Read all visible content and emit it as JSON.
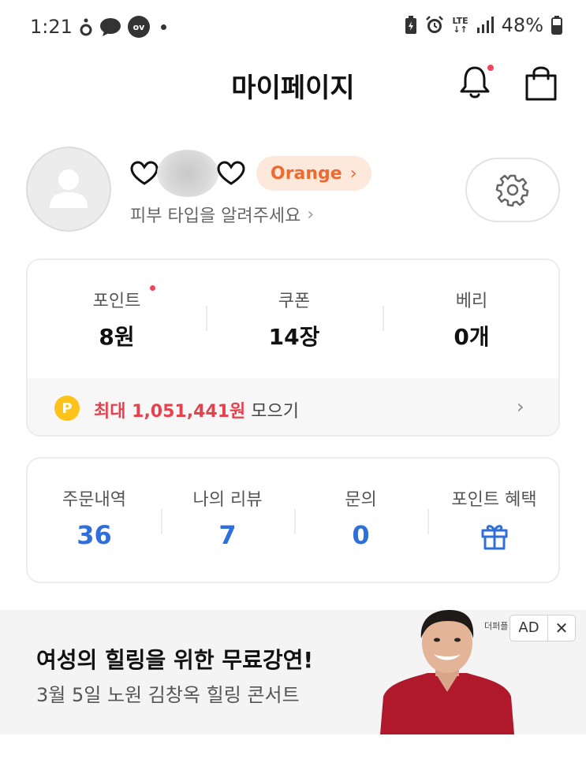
{
  "status_bar": {
    "time": "1:21",
    "ov_label": "ov",
    "battery": "48%",
    "network": "LTE"
  },
  "header": {
    "title": "마이페이지"
  },
  "profile": {
    "grade": "Orange",
    "skin_type_prompt": "피부 타입을 알려주세요"
  },
  "stats": [
    {
      "label": "포인트",
      "value": "8원"
    },
    {
      "label": "쿠폰",
      "value": "14장"
    },
    {
      "label": "베리",
      "value": "0개"
    }
  ],
  "collect": {
    "coin": "P",
    "highlight": "최대 1,051,441원",
    "suffix": " 모으기"
  },
  "orders": [
    {
      "label": "주문내역",
      "value": "36"
    },
    {
      "label": "나의 리뷰",
      "value": "7"
    },
    {
      "label": "문의",
      "value": "0"
    },
    {
      "label": "포인트 혜택",
      "icon": "gift-icon"
    }
  ],
  "ad": {
    "title": "여성의 힐링을 위한 무료강연!",
    "subtitle": "3월 5일 노원 김창옥 힐링 콘서트",
    "brand": "더퍼플",
    "badge": "AD",
    "close": "✕"
  },
  "colors": {
    "accent_orange": "#ee6b2f",
    "accent_blue": "#2f6fdc",
    "accent_red": "#e8414e",
    "coin_yellow": "#ffc21a"
  }
}
